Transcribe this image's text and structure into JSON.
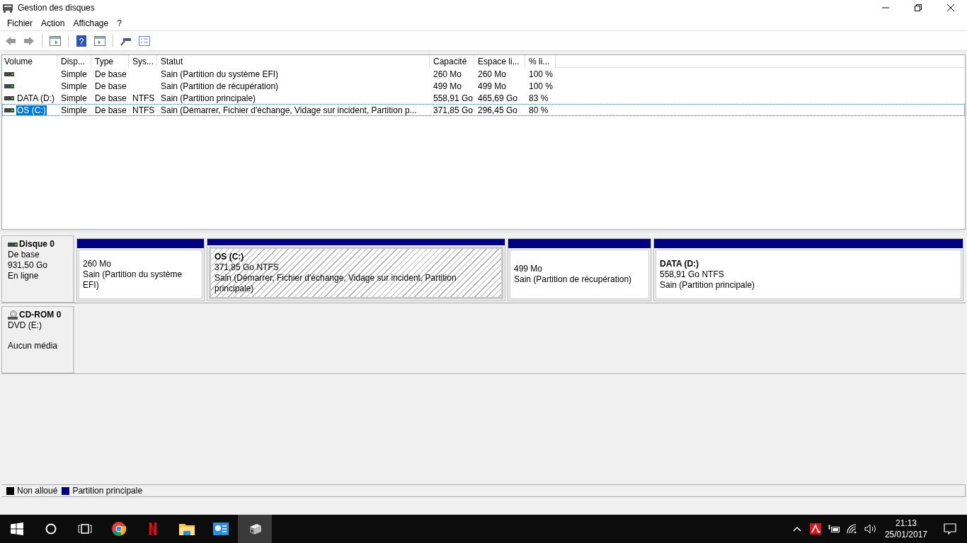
{
  "window": {
    "title": "Gestion des disques"
  },
  "menu": [
    "Fichier",
    "Action",
    "Affichage",
    "?"
  ],
  "toolbar": {
    "help_glyph": "?"
  },
  "volumes": {
    "columns": [
      "Volume",
      "Disp...",
      "Type",
      "Sys...",
      "Statut",
      "Capacité",
      "Espace li...",
      "% li..."
    ],
    "rows": [
      {
        "selected": false,
        "cells": [
          "",
          "Simple",
          "De base",
          "",
          "Sain (Partition du système EFI)",
          "260 Mo",
          "260 Mo",
          "100 %"
        ]
      },
      {
        "selected": false,
        "cells": [
          "",
          "Simple",
          "De base",
          "",
          "Sain (Partition de récupération)",
          "499 Mo",
          "499 Mo",
          "100 %"
        ]
      },
      {
        "selected": false,
        "cells": [
          "DATA (D:)",
          "Simple",
          "De base",
          "NTFS",
          "Sain (Partition principale)",
          "558,91 Go",
          "465,69 Go",
          "83 %"
        ]
      },
      {
        "selected": true,
        "cells": [
          "OS (C:)",
          "Simple",
          "De base",
          "NTFS",
          "Sain (Démarrer, Fichier d'échange, Vidage sur incident, Partition p...",
          "371,85 Go",
          "296,45 Go",
          "80 %"
        ]
      }
    ]
  },
  "disks": [
    {
      "kind": "disk",
      "name": "Disque 0",
      "lines": [
        "De base",
        "931,50 Go",
        "En ligne"
      ],
      "partitions": [
        {
          "selected": false,
          "size": "260 Mo",
          "status": "Sain (Partition du système EFI)"
        },
        {
          "selected": true,
          "title": "OS  (C:)",
          "size": "371,85 Go NTFS",
          "status": "Sain (Démarrer, Fichier d'échange, Vidage sur incident, Partition principale)"
        },
        {
          "selected": false,
          "size": "499 Mo",
          "status": "Sain (Partition de récupération)"
        },
        {
          "selected": false,
          "title": "DATA  (D:)",
          "size": "558,91 Go NTFS",
          "status": "Sain (Partition principale)"
        }
      ]
    },
    {
      "kind": "cdrom",
      "name": "CD-ROM 0",
      "lines": [
        "DVD (E:)"
      ],
      "note": "Aucun média"
    }
  ],
  "legend": [
    {
      "label": "Non alloué",
      "color": "#000000"
    },
    {
      "label": "Partition principale",
      "color": "#000080"
    }
  ],
  "taskbar": {
    "time": "21:13",
    "date": "25/01/2017"
  }
}
